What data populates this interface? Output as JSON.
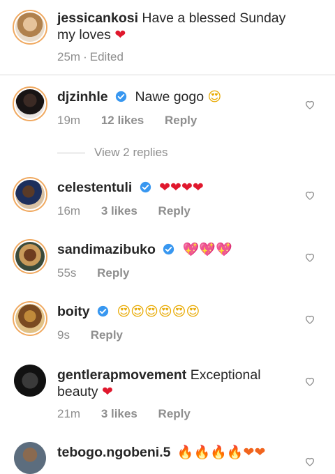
{
  "caption": {
    "username": "jessicankosi",
    "text": "Have a blessed Sunday my loves",
    "emoji": "❤",
    "time": "25m",
    "edited": "Edited"
  },
  "comments": [
    {
      "username": "djzinhle",
      "verified": true,
      "text": "Nawe gogo",
      "emoji": "😍",
      "time": "19m",
      "likes": "12 likes",
      "reply": "Reply"
    },
    {
      "username": "celestentuli",
      "verified": true,
      "text": "",
      "emoji": "❤❤❤❤",
      "time": "16m",
      "likes": "3 likes",
      "reply": "Reply"
    },
    {
      "username": "sandimazibuko",
      "verified": true,
      "text": "",
      "emoji": "💖💖💖",
      "time": "55s",
      "likes": "",
      "reply": "Reply"
    },
    {
      "username": "boity",
      "verified": true,
      "text": "",
      "emoji": "😍😍😍😍😍😍",
      "time": "9s",
      "likes": "",
      "reply": "Reply"
    },
    {
      "username": "gentlerapmovement",
      "verified": false,
      "text": "Exceptional beauty",
      "emoji": "❤",
      "time": "21m",
      "likes": "3 likes",
      "reply": "Reply"
    },
    {
      "username": "tebogo.ngobeni.5",
      "verified": false,
      "text": "",
      "emoji": "🔥🔥🔥🔥❤❤",
      "time": "",
      "likes": "",
      "reply": ""
    }
  ],
  "view_replies": "View 2 replies",
  "colors": {
    "verified": "#3897f0",
    "story_ring": "#f0a960",
    "heart": "#e0182d",
    "meta": "#8e8e8e"
  }
}
